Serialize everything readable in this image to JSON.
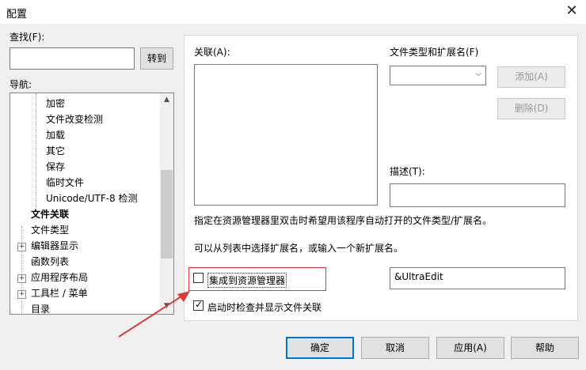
{
  "window": {
    "title": "配置"
  },
  "left": {
    "search_label": "查找(F):",
    "goto_button": "转到",
    "nav_label": "导航:",
    "tree_items": [
      {
        "label": "加密"
      },
      {
        "label": "文件改变检测"
      },
      {
        "label": "加载"
      },
      {
        "label": "其它"
      },
      {
        "label": "保存"
      },
      {
        "label": "临时文件"
      },
      {
        "label": "Unicode/UTF-8 检测"
      },
      {
        "label": "文件关联",
        "selected": true
      },
      {
        "label": "文件类型"
      },
      {
        "label": "编辑器显示",
        "expandable": true
      },
      {
        "label": "函数列表"
      },
      {
        "label": "应用程序布局",
        "expandable": true
      },
      {
        "label": "工具栏 / 菜单",
        "expandable": true
      },
      {
        "label": "目录"
      }
    ]
  },
  "panel": {
    "assoc_label": "关联(A):",
    "filetype_label": "文件类型和扩展名(F)",
    "add_button": "添加(A)",
    "delete_button": "删除(D)",
    "desc_label": "描述(T):",
    "info_line1": "指定在资源管理器里双击时希望用该程序自动打开的文件类型/扩展名。",
    "info_line2": "可以从列表中选择扩展名，或输入一个新扩展名。",
    "integrate_label": "集成到资源管理器",
    "integrate_checked": false,
    "integrate_value": "&UltraEdit",
    "startup_check_label": "启动时检查并显示文件关联",
    "startup_check_checked": true
  },
  "footer": {
    "ok": "确定",
    "cancel": "取消",
    "apply": "应用(A)",
    "help": "帮助"
  },
  "colors": {
    "annotation": "#e03a3a",
    "accent": "#0078d7"
  }
}
